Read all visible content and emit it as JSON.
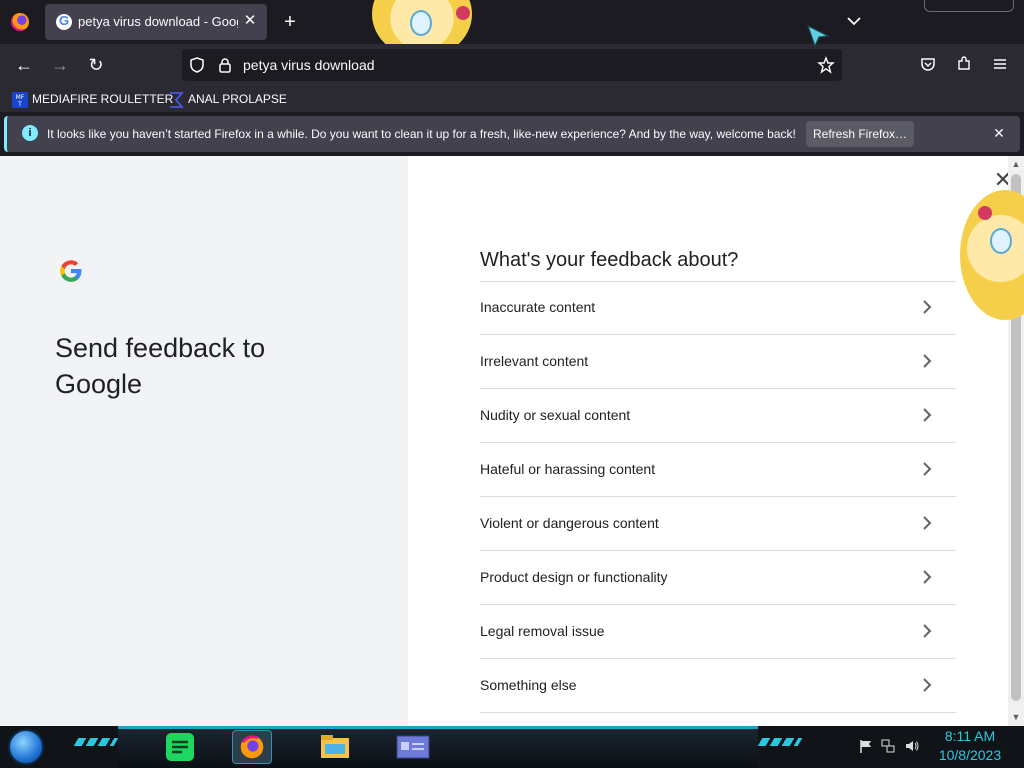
{
  "browser": {
    "tab": {
      "title": "petya virus download - Google Search",
      "favicon": "google-favicon"
    },
    "url": "petya virus download",
    "bookmarks": [
      {
        "label": "MEDIAFIRE ROULETTER",
        "icon": "mediafire-icon"
      },
      {
        "label": "ANAL PROLAPSE",
        "icon": "bookmark-sigma-icon"
      }
    ],
    "notification": {
      "text": "It looks like you haven’t started Firefox in a while. Do you want to clean it up for a fresh, like-new experience? And by the way, welcome back!",
      "button": "Refresh Firefox…"
    }
  },
  "page": {
    "title": "Send feedback to Google",
    "question": "What's your feedback about?",
    "options": [
      "Inaccurate content",
      "Irrelevant content",
      "Nudity or sexual content",
      "Hateful or harassing content",
      "Violent or dangerous content",
      "Product design or functionality",
      "Legal removal issue",
      "Something else"
    ]
  },
  "taskbar": {
    "time": "8:11 AM",
    "date": "10/8/2023"
  },
  "colors": {
    "accent": "#80ebff",
    "taskbar_accent": "#2ec7e0",
    "tab_active": "#42414d",
    "toolbar": "#2b2a33"
  }
}
